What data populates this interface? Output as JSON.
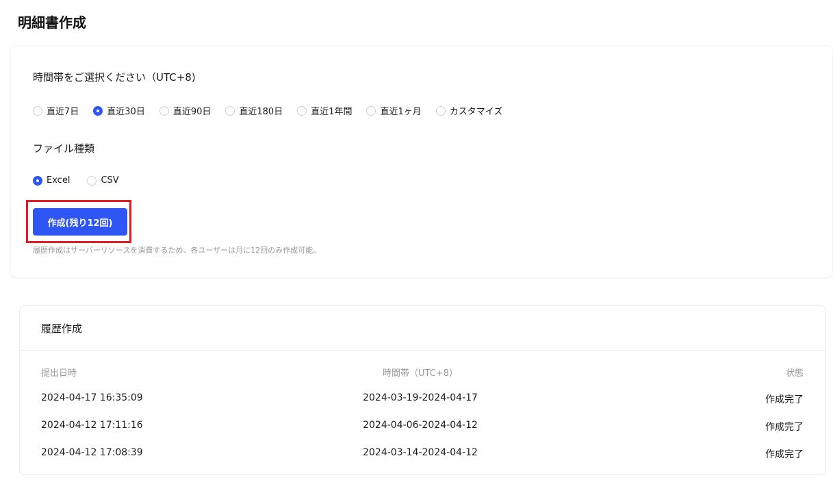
{
  "page_title": "明細書作成",
  "timezone_section": {
    "label": "時間帯をご選択ください（UTC+8)",
    "options": [
      "直近7日",
      "直近30日",
      "直近90日",
      "直近180日",
      "直近1年間",
      "直近1ヶ月",
      "カスタマイズ"
    ],
    "selected": "直近30日"
  },
  "file_type_section": {
    "label": "ファイル種類",
    "options": [
      "Excel",
      "CSV"
    ],
    "selected": "Excel"
  },
  "create_button_label": "作成(残り12回)",
  "note": "履歴作成はサーバーリソースを消費するため、各ユーザーは月に12回のみ作成可能。",
  "history": {
    "title": "履歴作成",
    "columns": [
      "提出日時",
      "時間帯（UTC+8）",
      "状態"
    ],
    "rows": [
      {
        "submitted": "2024-04-17 16:35:09",
        "range": "2024-03-19-2024-04-17",
        "status": "作成完了"
      },
      {
        "submitted": "2024-04-12 17:11:16",
        "range": "2024-04-06-2024-04-12",
        "status": "作成完了"
      },
      {
        "submitted": "2024-04-12 17:08:39",
        "range": "2024-03-14-2024-04-12",
        "status": "作成完了"
      }
    ]
  },
  "colors": {
    "accent": "#2f55f5",
    "highlight": "#e31b23",
    "muted_text": "#9a9a9a"
  }
}
